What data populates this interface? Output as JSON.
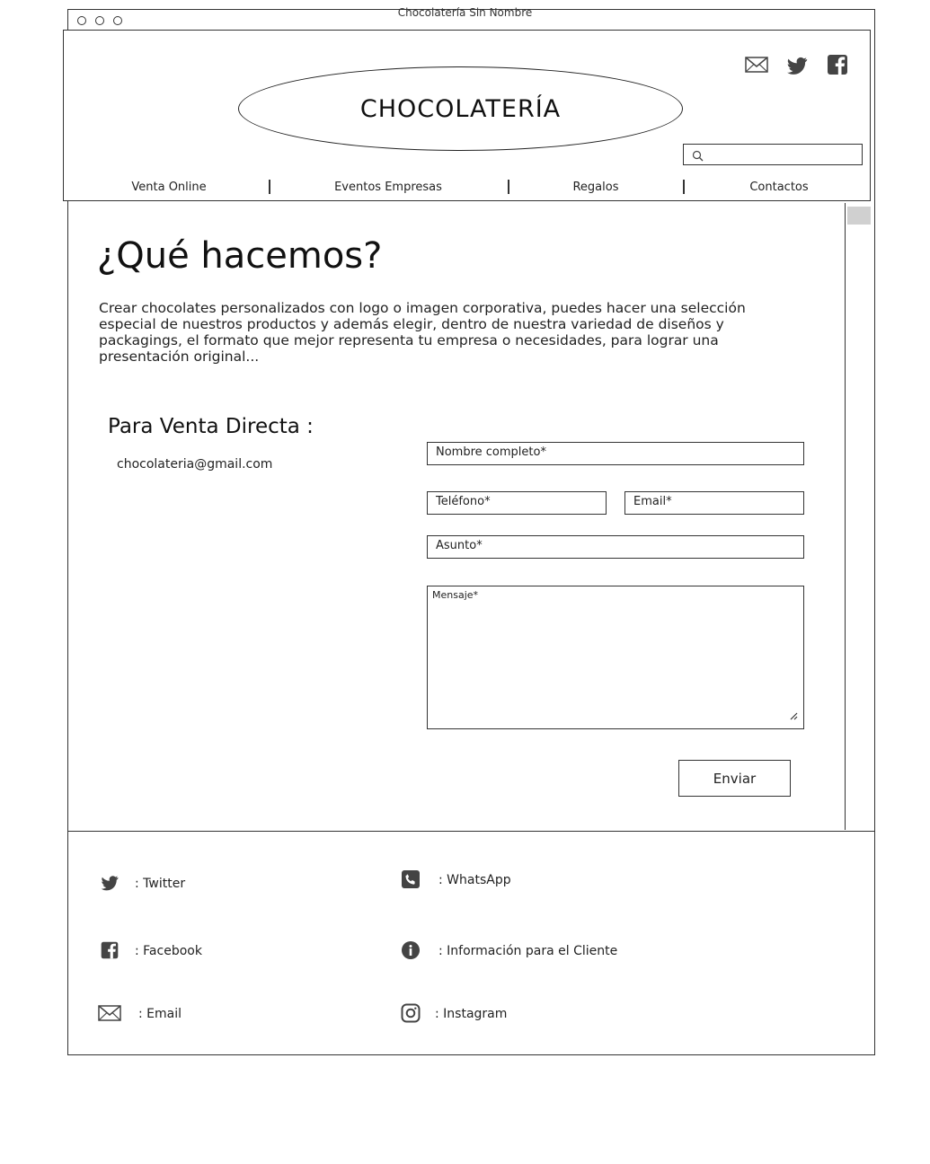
{
  "window": {
    "title": "Chocolatería Sin Nombre"
  },
  "header": {
    "logo_text": "CHOCOLATERÍA",
    "search": {
      "placeholder": ""
    },
    "social_icons": [
      "mail-icon",
      "twitter-icon",
      "facebook-icon"
    ],
    "nav": [
      {
        "label": "Venta Online"
      },
      {
        "label": "Eventos Empresas"
      },
      {
        "label": "Regalos"
      },
      {
        "label": "Contactos"
      }
    ]
  },
  "main": {
    "heading": "¿Qué hacemos?",
    "intro": " Crear chocolates personalizados con logo o imagen corporativa, puedes hacer una selección especial de nuestros productos y además elegir, dentro de nuestra variedad de diseños y packagings, el formato que mejor representa tu empresa o necesidades, para lograr una presentación original...",
    "direct_sale_heading": "Para Venta Directa :",
    "contact_email": "chocolateria@gmail.com",
    "form": {
      "full_name_placeholder": "Nombre completo*",
      "phone_placeholder": "Teléfono*",
      "email_placeholder": "Email*",
      "subject_placeholder": "Asunto*",
      "message_placeholder": "Mensaje*",
      "submit_label": "Enviar"
    }
  },
  "footer": {
    "links": [
      {
        "icon": "twitter-icon",
        "label": ": Twitter"
      },
      {
        "icon": "whatsapp-icon",
        "label": ": WhatsApp"
      },
      {
        "icon": "facebook-icon",
        "label": ": Facebook"
      },
      {
        "icon": "info-icon",
        "label": ": Información para el Cliente"
      },
      {
        "icon": "mail-icon",
        "label": ": Email"
      },
      {
        "icon": "instagram-icon",
        "label": ": Instagram"
      }
    ]
  }
}
